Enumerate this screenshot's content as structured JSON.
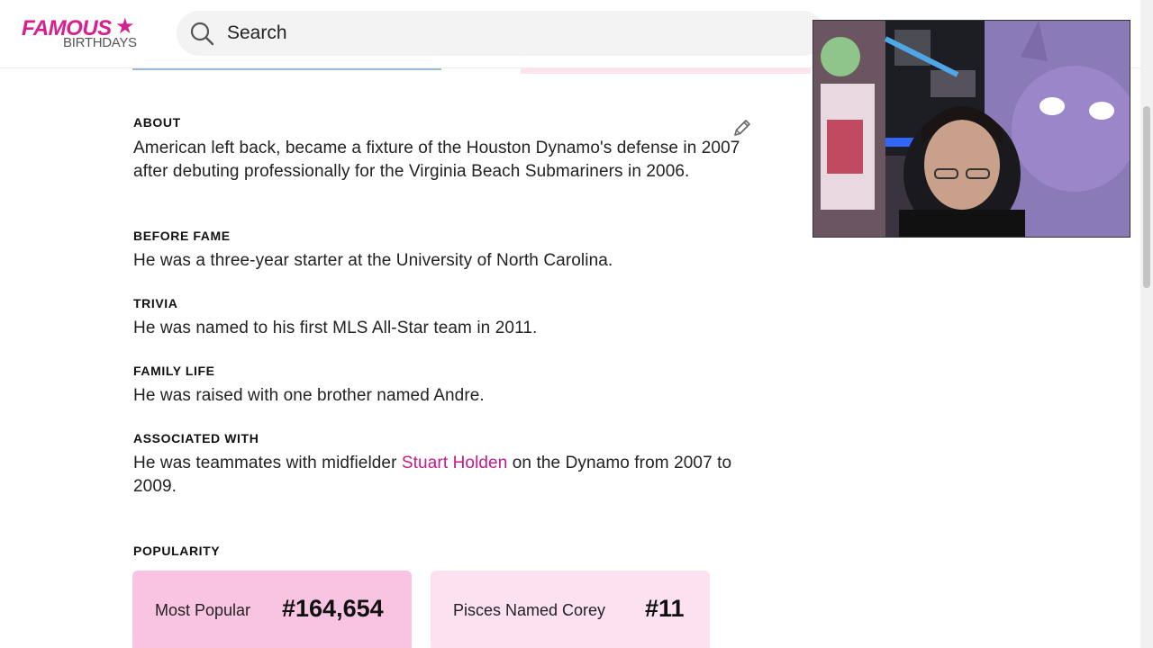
{
  "header": {
    "logo_top": "FAMOUS",
    "logo_bottom": "BIRTHDAYS",
    "search_placeholder": "Search"
  },
  "sections": {
    "about": {
      "label": "ABOUT",
      "text": "American left back, became a fixture of the Houston Dynamo's defense in 2007 after debuting professionally for the Virginia Beach Submariners in 2006."
    },
    "before_fame": {
      "label": "BEFORE FAME",
      "text": "He was a three-year starter at the University of North Carolina."
    },
    "trivia": {
      "label": "TRIVIA",
      "text": "He was named to his first MLS All-Star team in 2011."
    },
    "family_life": {
      "label": "FAMILY LIFE",
      "text": "He was raised with one brother named Andre."
    },
    "associated_with": {
      "label": "ASSOCIATED WITH",
      "text_before": "He was teammates with midfielder ",
      "link": "Stuart Holden",
      "text_after": " on the Dynamo from 2007 to 2009."
    },
    "popularity": {
      "label": "POPULARITY",
      "cards": [
        {
          "label": "Most Popular",
          "value": "#164,654"
        },
        {
          "label": "Pisces Named Corey",
          "value": "#11"
        }
      ]
    }
  },
  "colors": {
    "brand": "#d6208f",
    "link": "#c41a8a",
    "card_primary": "#f9c3e2",
    "card_secondary": "#fce2f0"
  },
  "icons": [
    "search-icon",
    "edit-pencil-icon",
    "star-icon"
  ]
}
